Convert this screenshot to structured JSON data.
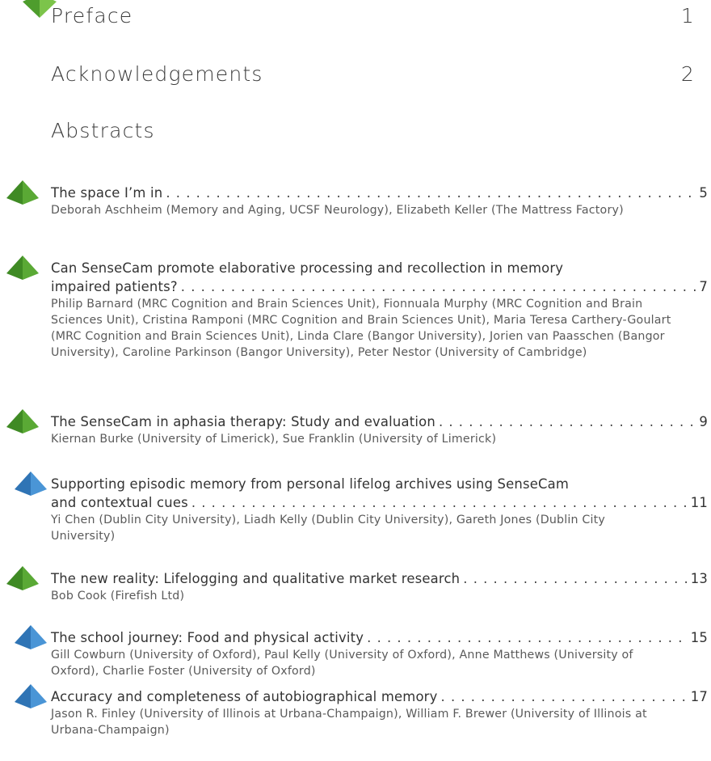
{
  "sections": {
    "preface": {
      "label": "Preface",
      "page": "1"
    },
    "acknowledgements": {
      "label": "Acknowledgements",
      "page": "2"
    },
    "abstracts": {
      "label": "Abstracts"
    }
  },
  "colors": {
    "green": "#5aa935",
    "green_dark": "#3f8a24",
    "blue": "#4a95d6",
    "blue_dark": "#2f74b5"
  },
  "entries": [
    {
      "icon": "green-pyramid-icon",
      "title_lines": [
        "The space I’m in"
      ],
      "page": "5",
      "authors": "Deborah Aschheim (Memory and Aging, UCSF Neurology), Elizabeth Keller (The Mattress Factory)"
    },
    {
      "icon": "green-pyramid-icon",
      "title_lines": [
        "Can SenseCam promote elaborative processing and recollection in memory",
        "impaired patients?"
      ],
      "page": "7",
      "authors": "Philip Barnard (MRC Cognition and Brain Sciences Unit), Fionnuala Murphy (MRC Cognition and Brain Sciences Unit), Cristina Ramponi (MRC Cognition and Brain Sciences Unit), Maria Teresa Carthery-Goulart (MRC Cognition and Brain Sciences Unit), Linda Clare (Bangor University), Jorien van Paasschen (Bangor University), Caroline Parkinson (Bangor University), Peter Nestor (University of Cambridge)"
    },
    {
      "icon": "green-pyramid-icon",
      "title_lines": [
        "The SenseCam in aphasia therapy: Study and evaluation"
      ],
      "page": "9",
      "authors": "Kiernan Burke (University of Limerick), Sue Franklin (University of Limerick)"
    },
    {
      "icon": "blue-pyramid-icon",
      "title_lines": [
        "Supporting episodic memory from personal lifelog archives using SenseCam",
        "and contextual cues"
      ],
      "page": "11",
      "authors": "Yi Chen (Dublin City University), Liadh Kelly (Dublin City University), Gareth Jones (Dublin City University)"
    },
    {
      "icon": "green-pyramid-icon",
      "title_lines": [
        "The new reality: Lifelogging and qualitative market research"
      ],
      "page": "13",
      "authors": "Bob Cook (Firefish Ltd)"
    },
    {
      "icon": "blue-pyramid-icon",
      "title_lines": [
        "The school journey: Food and physical activity"
      ],
      "page": "15",
      "authors": "Gill Cowburn (University of Oxford), Paul Kelly (University of Oxford), Anne Matthews (University of Oxford), Charlie Foster (University of Oxford)"
    },
    {
      "icon": "blue-pyramid-icon",
      "title_lines": [
        "Accuracy and completeness of autobiographical memory"
      ],
      "page": "17",
      "authors": "Jason R. Finley (University of Illinois at Urbana-Champaign), William F. Brewer (University of Illinois at Urbana-Champaign)"
    }
  ]
}
